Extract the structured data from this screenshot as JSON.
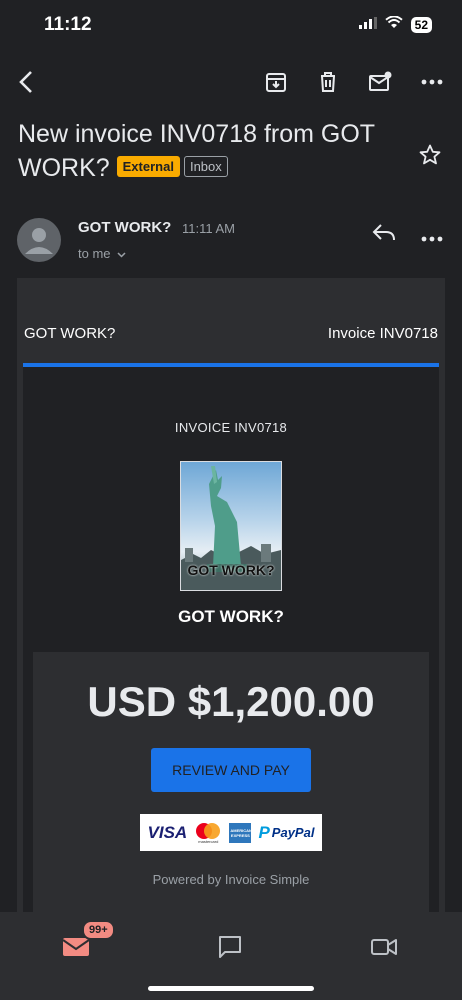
{
  "status_bar": {
    "time": "11:12",
    "battery": "52"
  },
  "toolbar": {
    "back_icon": "chevron-left-icon",
    "archive_icon": "archive-icon",
    "delete_icon": "trash-icon",
    "mark_unread_icon": "mail-unread-icon",
    "more_icon": "more-icon"
  },
  "email": {
    "subject": "New invoice INV0718 from GOT WORK?",
    "label_external": "External",
    "label_inbox": "Inbox",
    "sender": "GOT WORK?",
    "time": "11:11 AM",
    "recipient": "to me"
  },
  "invoice": {
    "header_company": "GOT WORK?",
    "header_invoice": "Invoice INV0718",
    "title": "INVOICE INV0718",
    "logo_text": "GOT WORK?",
    "company": "GOT WORK?",
    "amount": "USD $1,200.00",
    "pay_button": "REVIEW AND PAY",
    "payment_methods": [
      "VISA",
      "mastercard",
      "AMERICAN EXPRESS",
      "PayPal"
    ],
    "powered_by": "Powered by Invoice Simple"
  },
  "bottom_nav": {
    "mail_count": "99+"
  },
  "colors": {
    "accent": "#1a73e8",
    "external": "#f9ab00",
    "badge": "#f28b82",
    "background": "#202124"
  }
}
